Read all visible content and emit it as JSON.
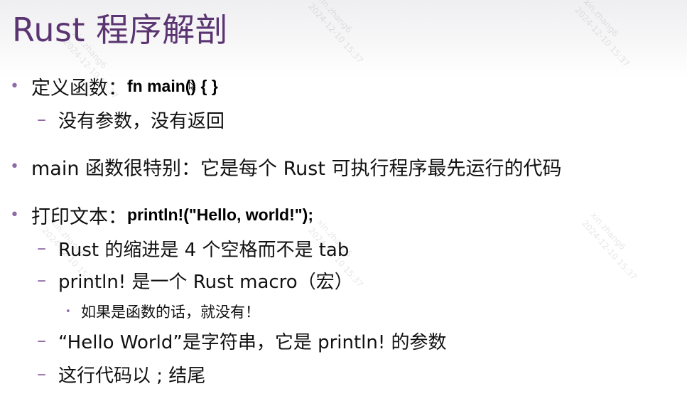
{
  "title": "Rust 程序解剖",
  "items": [
    {
      "text": "定义函数：",
      "code": "fn main() { }",
      "sub": [
        {
          "text": "没有参数，没有返回"
        }
      ]
    },
    {
      "text": "main 函数很特别：它是每个 Rust 可执行程序最先运行的代码"
    },
    {
      "text": "打印文本：",
      "code": "println!(\"Hello, world!\");",
      "sub": [
        {
          "text": "Rust 的缩进是 4 个空格而不是 tab"
        },
        {
          "text": "println! 是一个 Rust macro（宏）",
          "sub": [
            "如果是函数的话，就没有！"
          ]
        },
        {
          "text": "“Hello World”是字符串，它是 println! 的参数"
        },
        {
          "text": "这行代码以 ; 结尾"
        }
      ]
    }
  ],
  "watermarks": [
    {
      "user": "xin.zhang6",
      "date": "2024-12-10 15:37"
    },
    {
      "user": "xin.zhang6",
      "date": "2024-12-10 15:37"
    },
    {
      "user": "xin.zhang6",
      "date": "2024-12-10 15:37"
    },
    {
      "user": "xin.zhang6",
      "date": "2024-12-10 15:37"
    },
    {
      "user": "xin.zhang6",
      "date": "2024-12-10 15:37"
    },
    {
      "user": "xin.zhang6",
      "date": "2024-12-10 15:37"
    }
  ],
  "colors": {
    "title": "#5b3472",
    "bullet": "#8f6aa6"
  }
}
